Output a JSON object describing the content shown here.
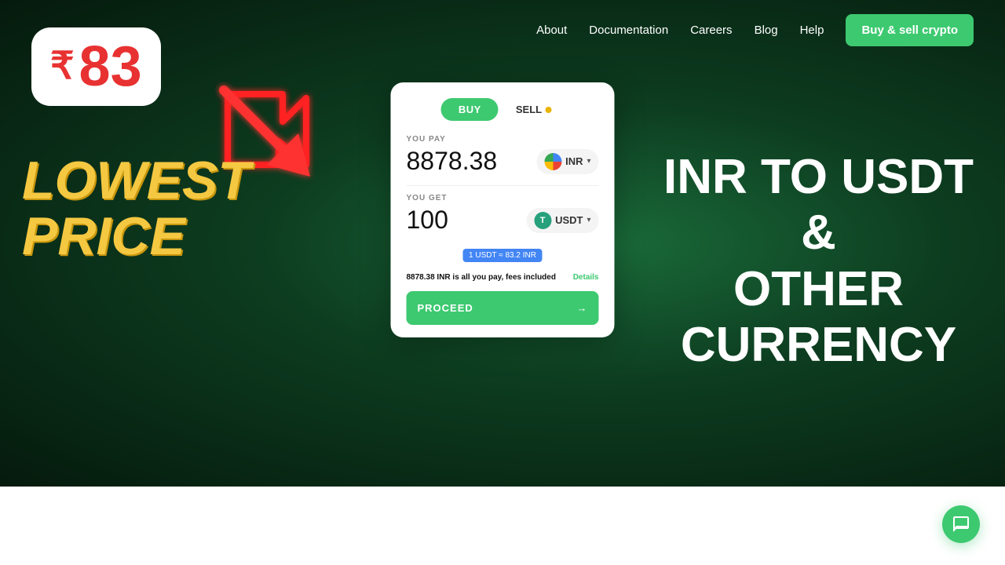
{
  "navbar": {
    "links": [
      "About",
      "Documentation",
      "Careers",
      "Blog",
      "Help"
    ],
    "cta_label": "Buy & sell crypto"
  },
  "hero": {
    "rupee_symbol": "₹",
    "rupee_number": "83",
    "lowest_price_line1": "LOWEST",
    "lowest_price_line2": "PRICE",
    "right_text_line1": "INR TO USDT",
    "right_text_amp": "&",
    "right_text_line2": "OTHER",
    "right_text_line3": "CURRENCY"
  },
  "widget": {
    "tab_buy": "BUY",
    "tab_sell": "SELL",
    "you_pay_label": "YOU PAY",
    "you_pay_amount": "8878.38",
    "you_pay_currency": "INR",
    "you_get_label": "YOU GET",
    "you_get_amount": "100",
    "you_get_currency": "USDT",
    "rate_badge": "1 USDT ≈ 83.2 INR",
    "fees_text_bold": "8878.38 INR",
    "fees_text_rest": " is all you pay, fees included",
    "details_label": "Details",
    "proceed_label": "PROCEED",
    "proceed_arrow": "→"
  },
  "chat": {
    "label": "chat-button"
  }
}
